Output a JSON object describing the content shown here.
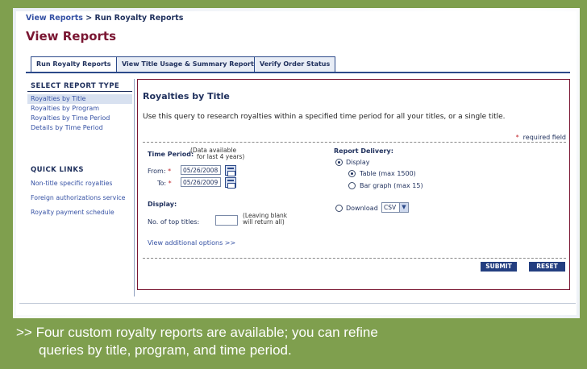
{
  "breadcrumb": {
    "parent": "View Reports",
    "sep": " > ",
    "current": "Run Royalty Reports"
  },
  "page_title": "View Reports",
  "tabs": [
    {
      "label": "Run Royalty Reports",
      "active": true
    },
    {
      "label": "View Title Usage & Summary Reports",
      "active": false
    },
    {
      "label": "Verify Order Status",
      "active": false
    }
  ],
  "sidebar": {
    "report_type_heading": "SELECT REPORT TYPE",
    "report_types": [
      "Royalties by Title",
      "Royalties by Program",
      "Royalties by Time Period",
      "Details by Time Period"
    ],
    "selected_index": 0,
    "quick_links_heading": "QUICK LINKS",
    "quick_links": [
      "Non-title specific royalties",
      "Foreign authorizations service",
      "Royalty payment schedule"
    ]
  },
  "panel": {
    "title": "Royalties by Title",
    "description": "Use this query to research royalties within a specified time period for all your titles, or a single title.",
    "required_star": "*",
    "required_text": "required field",
    "time_period_label": "Time Period:",
    "time_period_note_1": "(Data available",
    "time_period_note_2": "for last 4 years)",
    "from_label": "From:",
    "to_label": "To:",
    "from_value": "05/26/2008",
    "to_value": "05/26/2009",
    "display_label": "Display:",
    "top_titles_label": "No. of top titles:",
    "top_titles_note_1": "(Leaving blank",
    "top_titles_note_2": "will return all)",
    "additional_options": "View additional options >>",
    "delivery_label": "Report Delivery:",
    "display_option": "Display",
    "table_option": "Table (max 1500)",
    "bar_option": "Bar graph (max 15)",
    "download_option": "Download",
    "download_format": "CSV",
    "submit": "SUBMIT",
    "reset": "RESET"
  },
  "caption_line_1": ">> Four custom royalty reports are available; you can refine",
  "caption_line_2": "queries by title, program, and time period.",
  "colors": {
    "background": "#7f9f4e",
    "navy": "#1e2f5c",
    "maroon": "#7a1632",
    "link": "#3551a4"
  }
}
